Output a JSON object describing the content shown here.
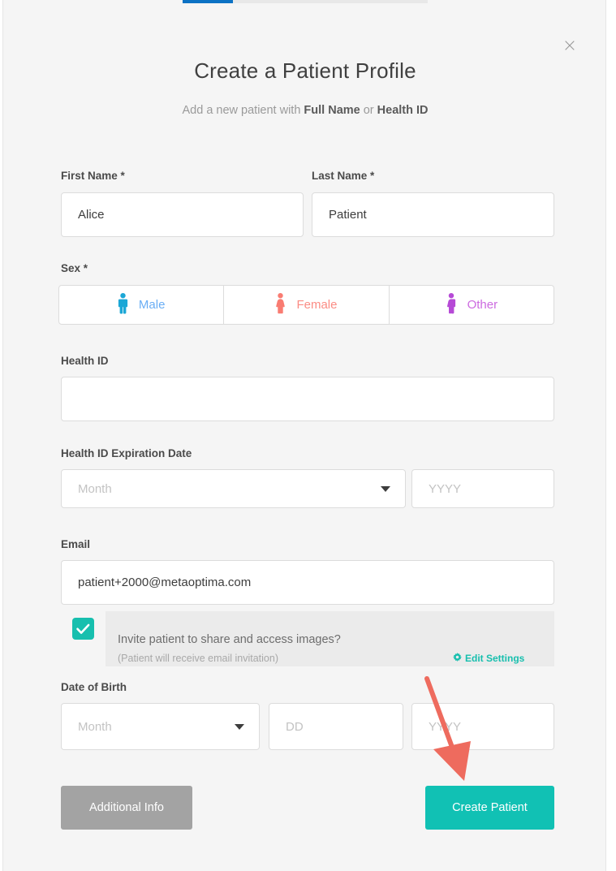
{
  "progress": {
    "percent": 20
  },
  "dialog": {
    "close_label": "×",
    "title": "Create a Patient Profile",
    "subtitle_prefix": "Add a new patient with ",
    "subtitle_bold_1": "Full Name",
    "subtitle_middle": " or ",
    "subtitle_bold_2": "Health ID"
  },
  "form": {
    "first_name": {
      "label": "First Name *",
      "value": "Alice",
      "placeholder": ""
    },
    "last_name": {
      "label": "Last Name *",
      "value": "Patient",
      "placeholder": ""
    },
    "sex": {
      "label": "Sex *",
      "options": [
        {
          "label": "Male",
          "icon": "male-figure-icon",
          "color": "#6aaef5",
          "icon_color": "#1ba7d6"
        },
        {
          "label": "Female",
          "icon": "female-figure-icon",
          "color": "#fb8c84",
          "icon_color": "#f97c72"
        },
        {
          "label": "Other",
          "icon": "other-figure-icon",
          "color": "#cc6ae0",
          "icon_color": "#b64ad6"
        }
      ],
      "selected": ""
    },
    "health_id": {
      "label": "Health ID",
      "value": "",
      "placeholder": ""
    },
    "health_id_expiration": {
      "label": "Health ID Expiration Date",
      "month_value": "",
      "month_placeholder": "Month",
      "year_value": "",
      "year_placeholder": "YYYY"
    },
    "email": {
      "label": "Email",
      "value": "patient+2000@metaoptima.com",
      "placeholder": ""
    },
    "invite": {
      "checked": true,
      "main_text": "Invite patient to share and access images?",
      "sub_text": "(Patient will receive email invitation)",
      "edit_settings_label": "Edit Settings"
    },
    "date_of_birth": {
      "label": "Date of Birth",
      "month_value": "",
      "month_placeholder": "Month",
      "day_value": "",
      "day_placeholder": "DD",
      "year_value": "",
      "year_placeholder": "YYYY"
    }
  },
  "actions": {
    "additional_info_label": "Additional Info",
    "create_patient_label": "Create Patient"
  },
  "colors": {
    "accent_teal": "#11c1b4",
    "progress_blue": "#0c72c4",
    "annotation_red": "#ee6b5e",
    "panel_gray": "#ebebeb",
    "dialog_bg": "#f5f5f5"
  }
}
